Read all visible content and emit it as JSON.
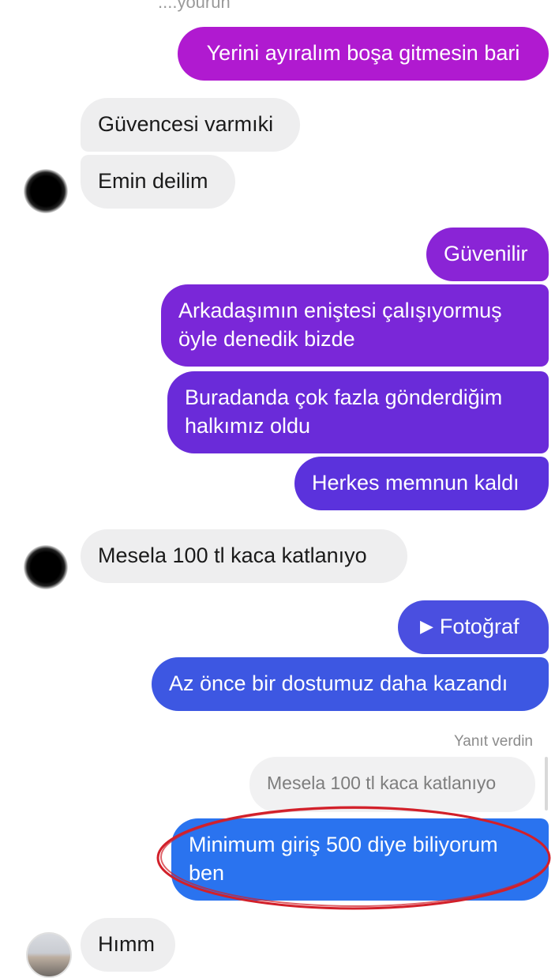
{
  "header": {
    "cut_text": "....yourun"
  },
  "messages": [
    {
      "text": "Yerini ayıralım boşa gitmesin bari"
    },
    {
      "text": "Güvencesi varmıki"
    },
    {
      "text": "Emin deilim"
    },
    {
      "text": "Güvenilir"
    },
    {
      "line1": "Arkadaşımın eniştesi çalışıyormuş",
      "line2": "öyle denedik bizde"
    },
    {
      "line1": "Buradanda çok fazla gönderdiğim",
      "line2": "halkımız oldu"
    },
    {
      "text": "Herkes memnun kaldı"
    },
    {
      "text": "Mesela 100 tl kaca  katlanıyo"
    },
    {
      "text": "Fotoğraf",
      "icon": "play-icon"
    },
    {
      "text": "Az önce bir dostumuz daha kazandı"
    },
    {
      "label": "Yanıt verdin",
      "quote": "Mesela 100 tl kaca  katlanıyo"
    },
    {
      "line1": "Minimum giriş 500 diye biliyorum",
      "line2": "ben"
    },
    {
      "text": "Hımm"
    }
  ],
  "colors": {
    "outgoing_top": "#b61bd0",
    "outgoing_mid": "#6c2bd9",
    "outgoing_bottom": "#1f6ff0",
    "incoming": "#eeeeef",
    "highlight_ring": "#d2202a"
  }
}
